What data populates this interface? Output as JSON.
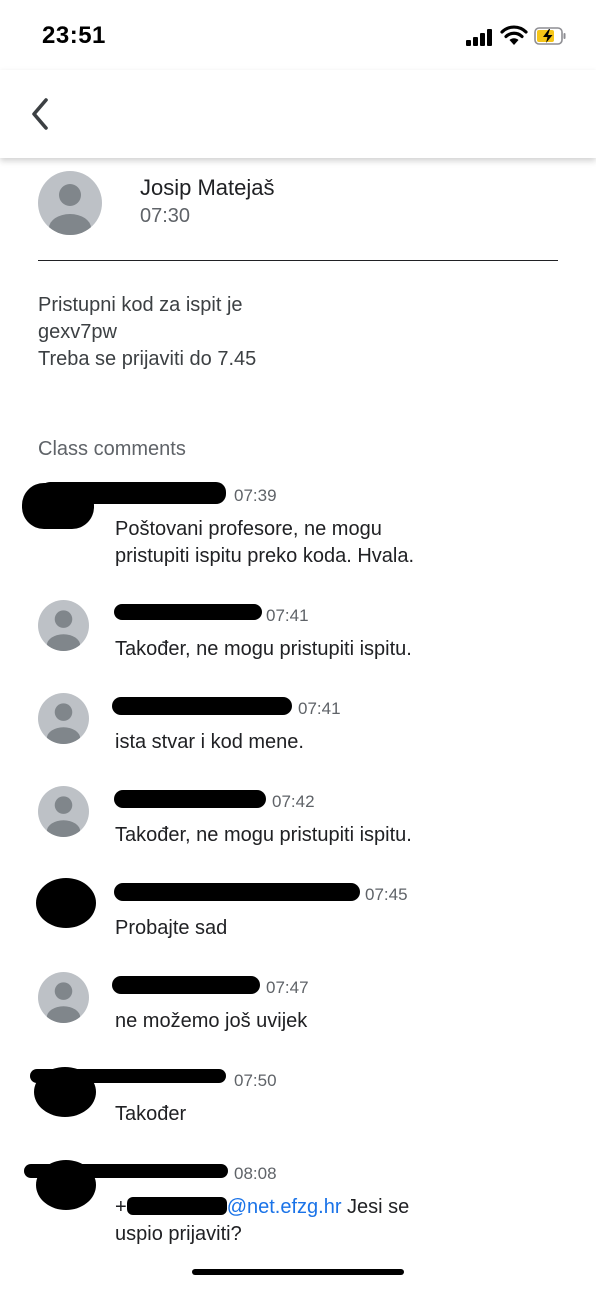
{
  "status_bar": {
    "time": "23:51"
  },
  "post": {
    "author": "Josip Matejaš",
    "time": "07:30",
    "body_lines": [
      "Pristupni kod za ispit je",
      "gexv7pw",
      "Treba se prijaviti do 7.45"
    ]
  },
  "comments_title": "Class comments",
  "comments": [
    {
      "time": "07:39",
      "lines": [
        "Poštovani profesore, ne mogu",
        "pristupiti ispitu preko koda. Hvala."
      ]
    },
    {
      "time": "07:41",
      "lines": [
        "Također, ne mogu pristupiti ispitu."
      ]
    },
    {
      "time": "07:41",
      "lines": [
        "ista stvar i kod mene."
      ]
    },
    {
      "time": "07:42",
      "lines": [
        "Također, ne mogu pristupiti ispitu."
      ]
    },
    {
      "time": "07:45",
      "lines": [
        "Probajte sad"
      ]
    },
    {
      "time": "07:47",
      "lines": [
        "ne možemo još uvijek"
      ]
    },
    {
      "time": "07:50",
      "lines": [
        "Također"
      ]
    },
    {
      "time": "08:08",
      "mention_prefix": "+",
      "mention_domain": "@net.efzg.hr",
      "mention_rest": " Jesi se",
      "line2": "uspio prijaviti?"
    }
  ]
}
